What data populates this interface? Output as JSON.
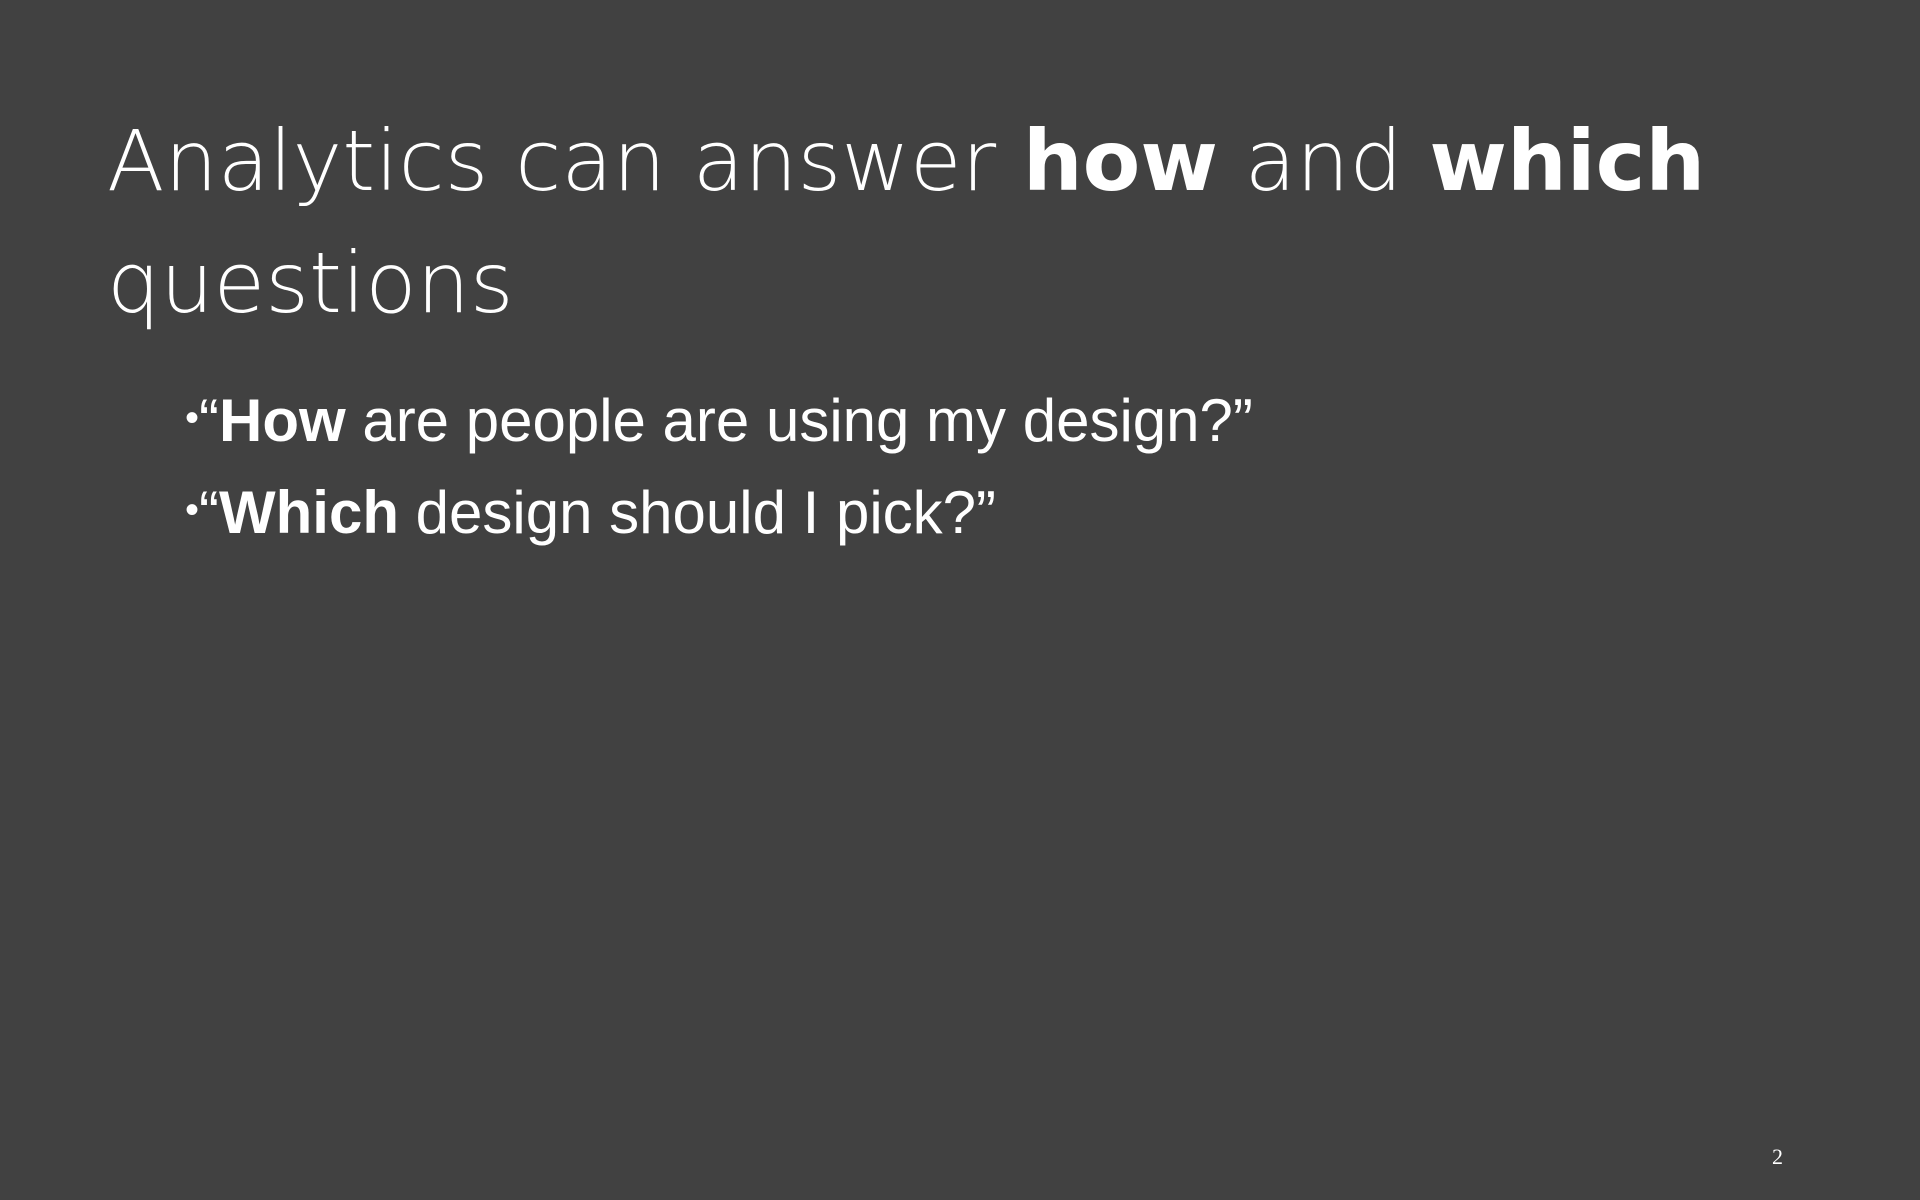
{
  "slide": {
    "title": {
      "part1": "Analytics can answer ",
      "bold1": "how",
      "part2": " and ",
      "bold2": "which",
      "part3": " questions"
    },
    "bullets": [
      {
        "marker": "•",
        "open_quote": "“",
        "bold": "How",
        "rest": " are people are using my design?”"
      },
      {
        "marker": "•",
        "open_quote": "“",
        "bold": "Which",
        "rest": " design should I pick?”"
      }
    ],
    "page_number": "2"
  }
}
